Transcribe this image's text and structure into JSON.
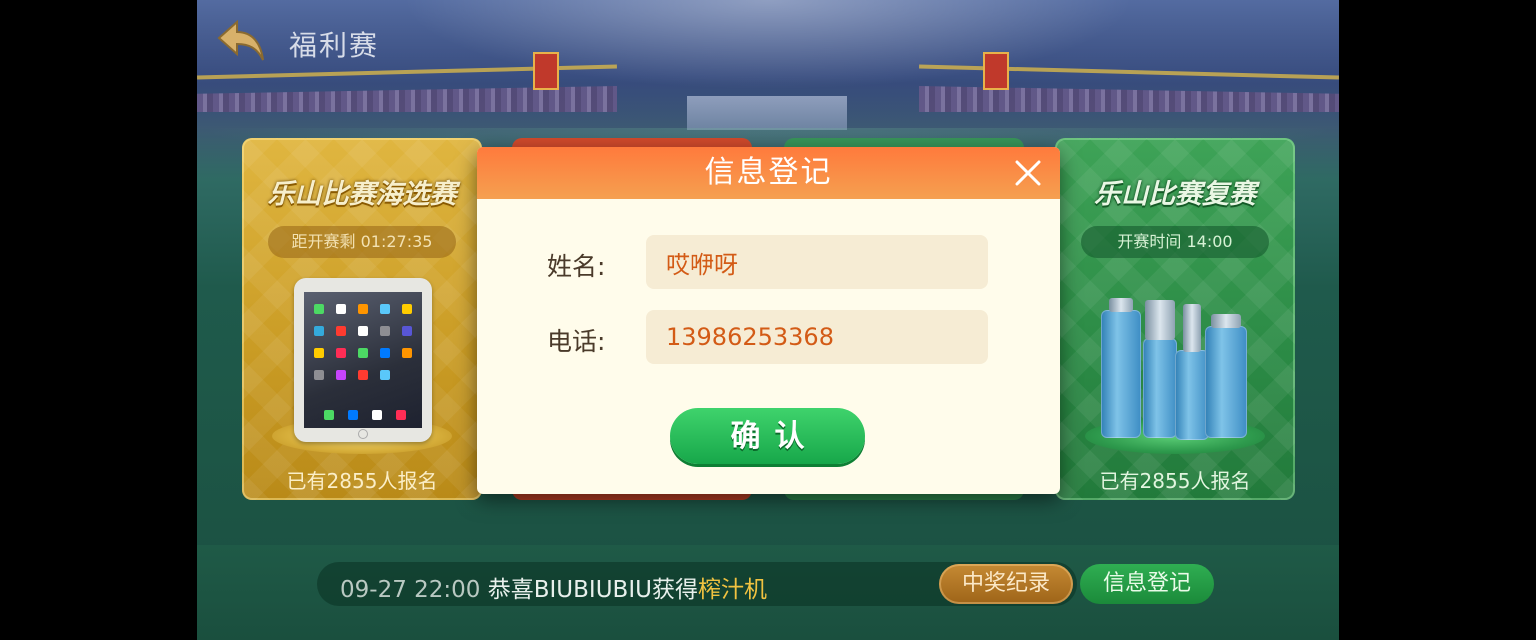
{
  "page": {
    "title": "福利赛"
  },
  "cards": [
    {
      "title": "乐山比赛海选赛",
      "pill": "距开赛剩 01:27:35",
      "count": "已有2855人报名",
      "prize_icon": "ipad-icon"
    },
    {
      "title": "乐山比赛复赛",
      "pill": "开赛时间 14:00",
      "count": "已有2855人报名",
      "prize_icon": "skincare-bottles-icon"
    }
  ],
  "ticker": {
    "time": "09-27 22:00",
    "message": "恭喜BIUBIUBIU获得",
    "prize": "榨汁机"
  },
  "buttons": {
    "records": "中奖纪录",
    "register": "信息登记"
  },
  "dialog": {
    "title": "信息登记",
    "name_label": "姓名:",
    "name_value": "哎咿呀",
    "phone_label": "电话:",
    "phone_value": "13986253368",
    "confirm": "确认"
  },
  "colors": {
    "accent_orange": "#ff7a3c",
    "confirm_green": "#1fb451",
    "input_text": "#d35b16"
  }
}
